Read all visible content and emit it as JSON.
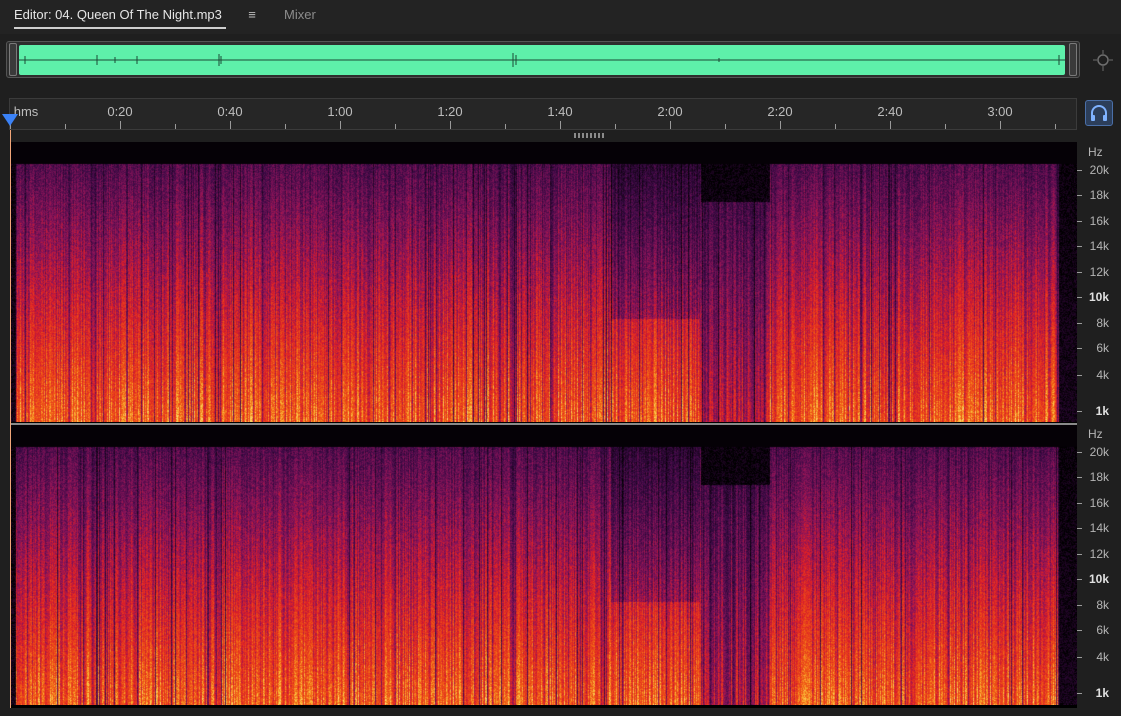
{
  "tabs": {
    "editor_label": "Editor: 04. Queen Of The Night.mp3",
    "menu_icon": "≡",
    "mixer_label": "Mixer"
  },
  "ruler": {
    "unit_label": "hms",
    "time_labels": [
      "0:20",
      "0:40",
      "1:00",
      "1:20",
      "1:40",
      "2:00",
      "2:20",
      "2:40",
      "3:00"
    ]
  },
  "freq_scale": {
    "unit": "Hz",
    "labels": [
      "20k",
      "18k",
      "16k",
      "14k",
      "12k",
      "10k",
      "8k",
      "6k",
      "4k",
      "1k"
    ],
    "bold_labels": [
      "10k",
      "1k"
    ]
  },
  "colors": {
    "overview_wave": "#5ef0aa",
    "playhead": "#3b82f6",
    "spectrogram_low": "#ffe27a",
    "spectrogram_mid": "#e0201c",
    "spectrogram_high": "#5a1a6a"
  },
  "icons": {
    "zoom": "zoom-navigator-icon",
    "headphones": "headphones-icon",
    "menu": "menu-icon"
  }
}
